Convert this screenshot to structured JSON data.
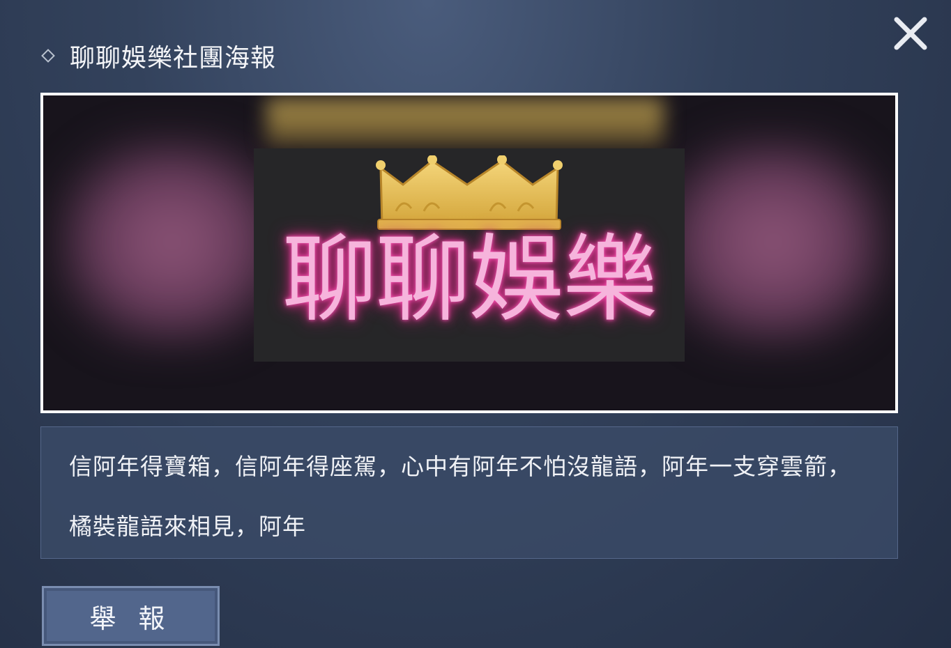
{
  "dialog": {
    "title": "聊聊娛樂社團海報",
    "close_icon": "close-icon"
  },
  "poster": {
    "neon_text": "聊聊娛樂",
    "crown_icon": "crown-icon",
    "colors": {
      "neon": "#f6b4dc",
      "crown": "#e8c25a",
      "side_glow": "#8e5578"
    }
  },
  "description": {
    "text": "信阿年得寶箱，信阿年得座駕，心中有阿年不怕沒龍語，阿年一支穿雲箭，橘裝龍語來相見，阿年"
  },
  "buttons": {
    "report_label": "舉 報"
  }
}
